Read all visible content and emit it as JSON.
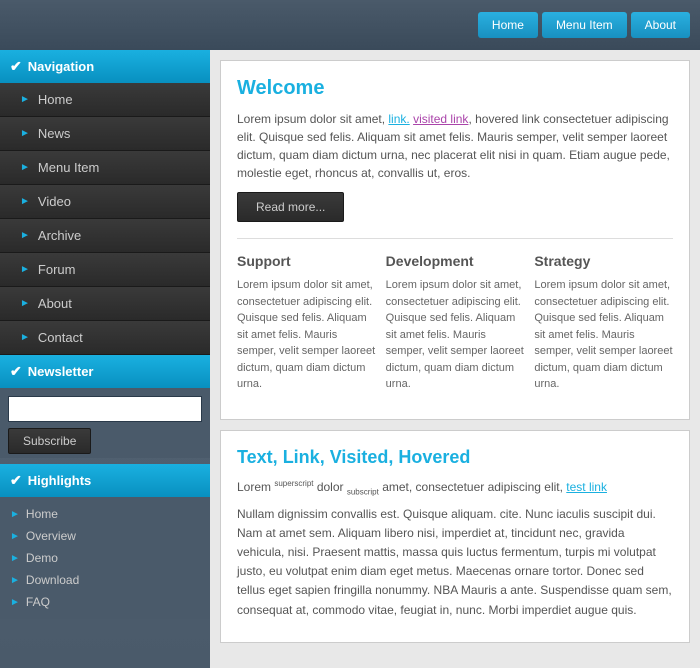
{
  "topbar": {
    "buttons": [
      {
        "label": "Home",
        "name": "home"
      },
      {
        "label": "Menu Item",
        "name": "menu-item"
      },
      {
        "label": "About",
        "name": "about"
      }
    ]
  },
  "sidebar": {
    "nav_header": "Navigation",
    "nav_items": [
      {
        "label": "Home"
      },
      {
        "label": "News"
      },
      {
        "label": "Menu Item"
      },
      {
        "label": "Video"
      },
      {
        "label": "Archive"
      },
      {
        "label": "Forum"
      },
      {
        "label": "About"
      },
      {
        "label": "Contact"
      }
    ],
    "newsletter_header": "Newsletter",
    "newsletter_input_placeholder": "",
    "subscribe_label": "Subscribe",
    "highlights_header": "Highlights",
    "highlights_items": [
      {
        "label": "Home"
      },
      {
        "label": "Overview"
      },
      {
        "label": "Demo"
      },
      {
        "label": "Download"
      },
      {
        "label": "FAQ"
      }
    ]
  },
  "content": {
    "welcome_title": "Welcome",
    "welcome_text": "Lorem ipsum dolor sit amet, ",
    "welcome_text2": ", hovered link consectetuer adipiscing elit. Quisque sed felis. Aliquam sit amet felis. Mauris semper, velit semper laoreet dictum, quam diam dictum urna, nec placerat elit nisi in quam. Etiam augue pede, molestie eget, rhoncus at, convallis ut, eros.",
    "link_text": "link.",
    "visited_text": "visited link",
    "read_more": "Read more...",
    "col1_title": "Support",
    "col1_text": "Lorem ipsum dolor sit amet, consectetuer adipiscing elit. Quisque sed felis. Aliquam sit amet felis. Mauris semper, velit semper laoreet dictum, quam diam dictum urna.",
    "col2_title": "Development",
    "col2_text": "Lorem ipsum dolor sit amet, consectetuer adipiscing elit. Quisque sed felis. Aliquam sit amet felis. Mauris semper, velit semper laoreet dictum, quam diam dictum urna.",
    "col3_title": "Strategy",
    "col3_text": "Lorem ipsum dolor sit amet, consectetuer adipiscing elit. Quisque sed felis. Aliquam sit amet felis. Mauris semper, velit semper laoreet dictum, quam diam dictum urna.",
    "text2_title_1": "Text, ",
    "text2_title_2": "Link,",
    "text2_title_3": " Visited, Hovered",
    "text2_p1_pre": "Lorem ",
    "text2_sup": "superscript",
    "text2_mid": " dolor ",
    "text2_sub": "subscript",
    "text2_post": " amet, consectetuer adipiscing elit, ",
    "text2_testlink": "test link",
    "text2_p2": "Nullam dignissim convallis est. Quisque aliquam. cite. Nunc iaculis suscipit dui. Nam at amet sem. Aliquam libero nisi, imperdiet at, tincidunt nec, gravida vehicula, nisi. Praesent mattis, massa quis luctus fermentum, turpis mi volutpat justo, eu volutpat enim diam eget metus. Maecenas ornare tortor. Donec sed tellus eget sapien fringilla nonummy. NBA Mauris a ante. Suspendisse quam sem, consequat at, commodo vitae, feugiat in, nunc. Morbi imperdiet augue quis."
  }
}
